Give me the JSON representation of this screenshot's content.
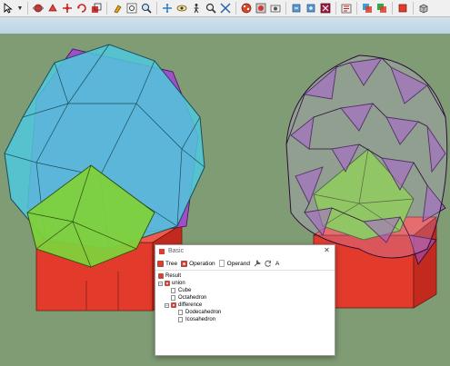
{
  "toolbar": {
    "icons": [
      "select-arrow-icon",
      "dropdown-arrow-icon",
      "orbit-icon",
      "orbit-red-icon",
      "move-icon",
      "rotate-icon",
      "scale-icon",
      "paint-icon",
      "zoom-extents-icon",
      "zoom-window-icon",
      "pan-icon",
      "look-around-icon",
      "walk-icon",
      "zoom-icon",
      "zoom-fit-icon",
      "section-icon",
      "display-section-icon",
      "camera-icon",
      "import-icon",
      "export-icon",
      "solid-tools-icon",
      "outer-shell-icon",
      "intersect-icon",
      "union-icon",
      "component-icon",
      "materials-icon"
    ]
  },
  "dialog": {
    "title": "Basic",
    "close_glyph": "✕",
    "tools": {
      "tree": "Tree",
      "operation": "Operation",
      "operand": "Operand",
      "text_glyph": "A"
    },
    "tree": {
      "root": "Result",
      "union": "union",
      "cube": "Cube",
      "octahedron": "Octahedron",
      "difference": "difference",
      "dodecahedron": "Dodecahedron",
      "icosahedron": "Icosahedron",
      "expanded_glyph": "−"
    }
  },
  "colors": {
    "ground": "#7f9c74",
    "cyan_solid": "#4fc9dd",
    "purple_solid": "#a14ecb",
    "green_solid": "#7fd13b",
    "red_solid": "#e23b2c"
  }
}
